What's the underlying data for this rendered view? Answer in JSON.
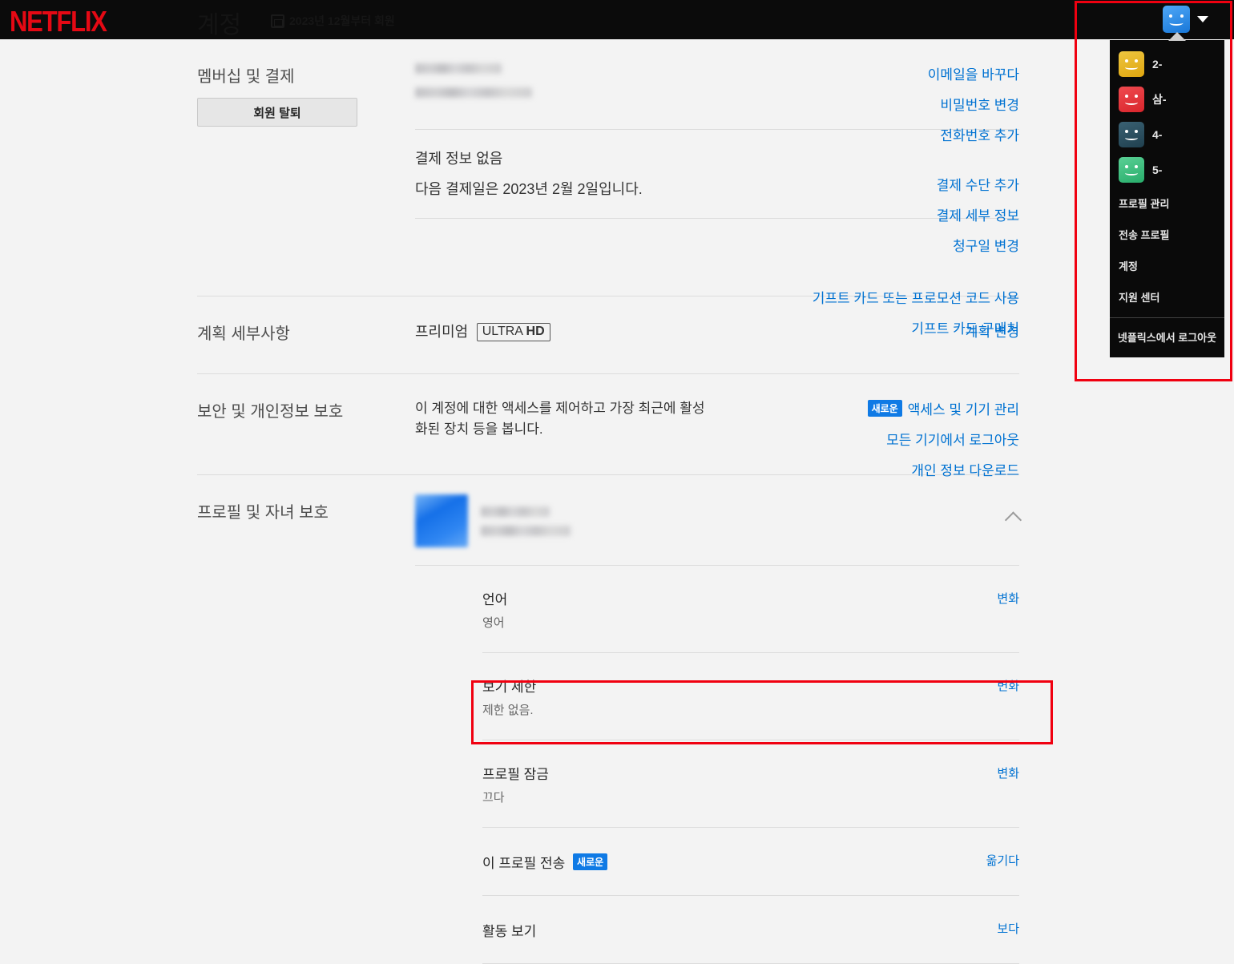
{
  "header": {
    "logo": "NETFLIX",
    "page_title": "계정",
    "member_since": "2023년 12월부터 회원",
    "calendar_icon": "calendar-icon"
  },
  "account_menu": {
    "avatar_icon": "profile-avatar-icon",
    "caret_icon": "chevron-down-icon",
    "profiles": [
      {
        "name": "2-",
        "color": "#e8b81f"
      },
      {
        "name": "삼-",
        "color": "#e5363b"
      },
      {
        "name": "4-",
        "color": "#2c4e5e"
      },
      {
        "name": "5-",
        "color": "#3fbe7e"
      }
    ],
    "links": [
      "프로필 관리",
      "전송 프로필",
      "계정",
      "지원 센터"
    ],
    "logout": "넷플릭스에서 로그아웃"
  },
  "membership": {
    "label": "멤버십 및 결제",
    "unsubscribe_button": "회원 탈퇴",
    "email_links": [
      "이메일을 바꾸다",
      "비밀번호 변경",
      "전화번호 추가"
    ],
    "payment_status": "결제 정보 없음",
    "next_billing": "다음 결제일은 2023년 2월 2일입니다.",
    "payment_links": [
      "결제 수단 추가",
      "결제 세부 정보",
      "청구일 변경"
    ],
    "gift_links": [
      "기프트 카드 또는 프로모션 코드 사용",
      "기프트 카드 구매처"
    ]
  },
  "plan": {
    "label": "계획 세부사항",
    "tier": "프리미엄",
    "quality_prefix": "ULTRA",
    "quality_suffix": "HD",
    "change_link": "계획 변경"
  },
  "security": {
    "label": "보안 및 개인정보 보호",
    "description_line1": "이 계정에 대한 액세스를 제어하고 가장 최근에 활성",
    "description_line2": "화된 장치 등을 봅니다.",
    "new_badge": "새로운",
    "links": [
      "액세스 및 기기 관리",
      "모든 기기에서 로그아웃",
      "개인 정보 다운로드"
    ]
  },
  "profiles_section": {
    "label": "프로필 및 자녀 보호",
    "collapse_icon": "chevron-up-icon",
    "rows": [
      {
        "title": "언어",
        "sub": "영어",
        "action": "변화"
      },
      {
        "title": "보기 제한",
        "sub": "제한 없음.",
        "action": "변화"
      },
      {
        "title": "프로필 잠금",
        "sub": "끄다",
        "action": "변화",
        "highlighted": true
      },
      {
        "title": "이 프로필 전송",
        "badge": "새로운",
        "action": "옮기다"
      },
      {
        "title": "활동 보기",
        "action": "보다"
      }
    ]
  },
  "highlight_color": "#f00010"
}
